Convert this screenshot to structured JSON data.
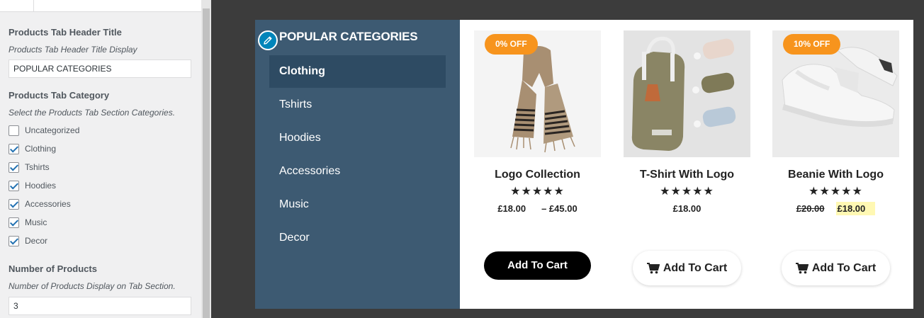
{
  "customizer": {
    "header_title_label": "Products Tab Header Title",
    "header_title_desc": "Products Tab Header Title Display",
    "header_title_value": "POPULAR CATEGORIES",
    "category_label": "Products Tab Category",
    "category_desc": "Select the Products Tab Section Categories.",
    "categories": [
      {
        "label": "Uncategorized",
        "checked": false
      },
      {
        "label": "Clothing",
        "checked": true
      },
      {
        "label": "Tshirts",
        "checked": true
      },
      {
        "label": "Hoodies",
        "checked": true
      },
      {
        "label": "Accessories",
        "checked": true
      },
      {
        "label": "Music",
        "checked": true
      },
      {
        "label": "Decor",
        "checked": true
      }
    ],
    "number_label": "Number of Products",
    "number_desc": "Number of Products Display on Tab Section.",
    "number_value": "3"
  },
  "preview": {
    "heading": "POPULAR CATEGORIES",
    "nav_items": [
      "Clothing",
      "Tshirts",
      "Hoodies",
      "Accessories",
      "Music",
      "Decor"
    ],
    "active_nav": "Clothing",
    "products": [
      {
        "name": "Logo Collection",
        "badge": "0% OFF",
        "stars": "★★★★★",
        "price_min": "£18.00",
        "price_max": "– £45.00",
        "button": "Add To Cart",
        "image": "scarf-image"
      },
      {
        "name": "T-Shirt With Logo",
        "badge": "",
        "stars": "★★★★★",
        "price": "£18.00",
        "button": "Add To Cart",
        "image": "backpack-image"
      },
      {
        "name": "Beanie With Logo",
        "badge": "10% OFF",
        "stars": "★★★★★",
        "price_old": "£20.00",
        "price_sale": "£18.00",
        "button": "Add To Cart",
        "image": "sneaker-image"
      }
    ]
  },
  "colors": {
    "category_panel": "#3d5a72",
    "category_active": "#2e4b63",
    "badge": "#f7941d",
    "edit_pencil": "#0085ba",
    "checkbox_check": "#2271b1"
  }
}
